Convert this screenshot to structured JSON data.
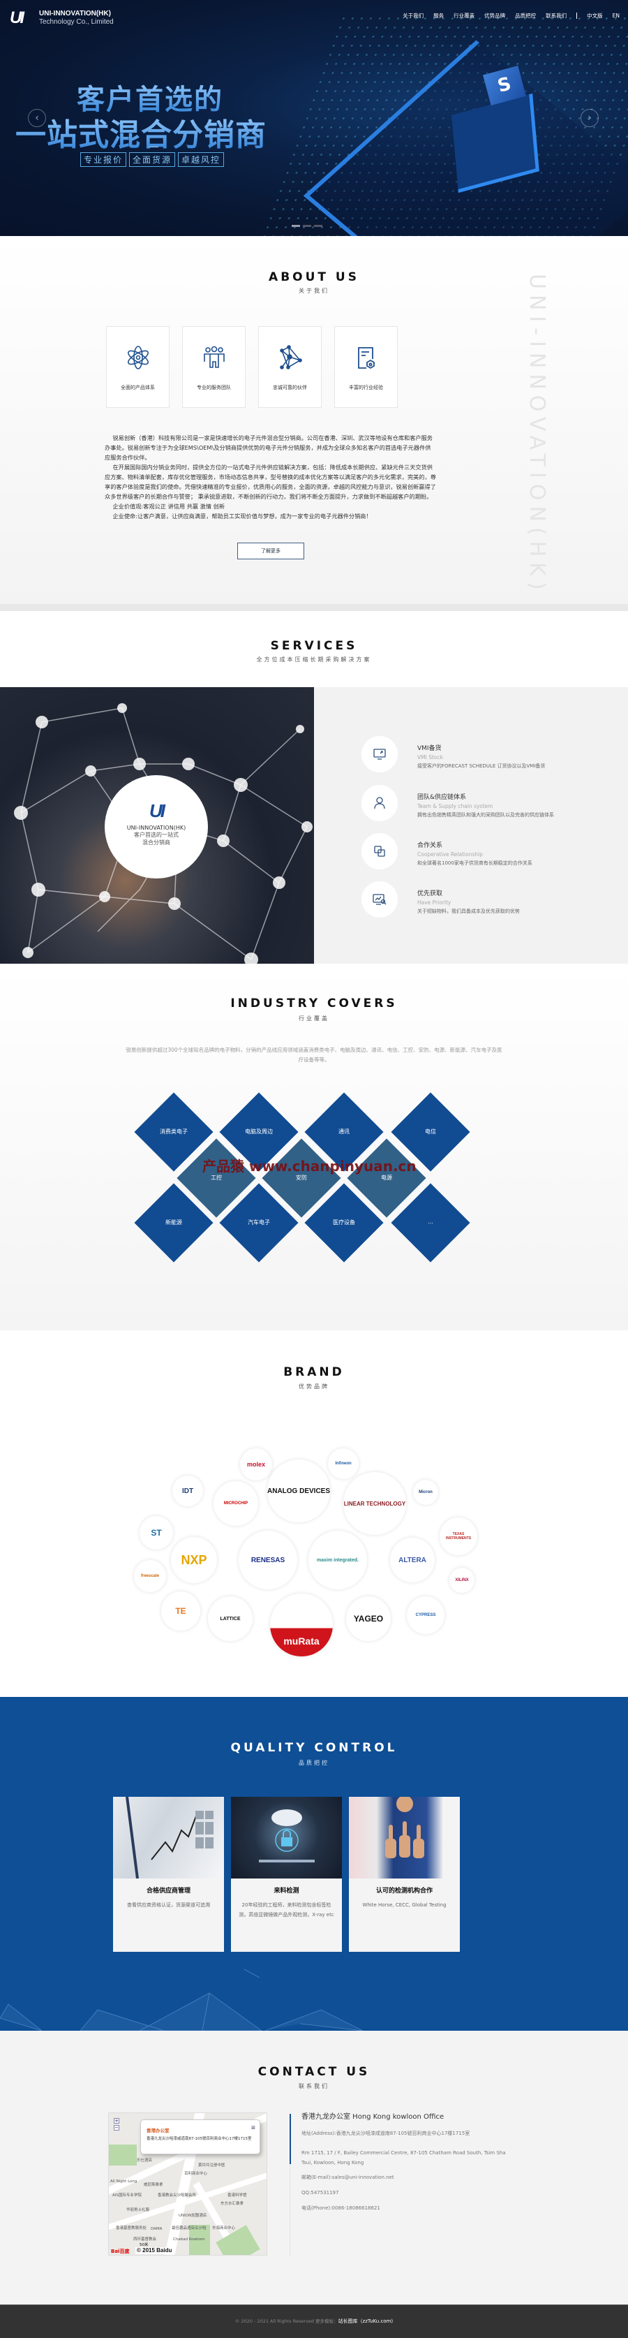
{
  "header": {
    "logo_line1": "UNI-INNOVATION(HK)",
    "logo_line2": "Technology Co., Limited",
    "logo_mark": "UI",
    "nav": [
      "关于我们",
      "服务",
      "行业覆盖",
      "优势品牌",
      "品质把控",
      "联系我们"
    ],
    "lang_cn": "中文版",
    "lang_en": "EN"
  },
  "hero": {
    "title_line1": "客户首选的",
    "title_line2": "一站式混合分销商",
    "tags": [
      "专业报价",
      "全面货源",
      "卓越风控"
    ],
    "chip_mark": "S",
    "prev_icon": "chevron-left-icon",
    "next_icon": "chevron-right-icon",
    "slides": 3,
    "active_slide": 1
  },
  "about": {
    "title": "ABOUT US",
    "subtitle": "关于我们",
    "watermark": "UNI-INNOVATION(HK)",
    "cards": [
      {
        "icon": "atom-icon",
        "label": "全面的产品体系"
      },
      {
        "icon": "team-icon",
        "label": "专业的服务团队"
      },
      {
        "icon": "network-icon",
        "label": "忠诚可靠的伙伴"
      },
      {
        "icon": "certificate-icon",
        "label": "丰富的行业经验"
      }
    ],
    "paragraphs": [
      "锐易创新（香港）科技有限公司是一家是快速增长的电子元件混合型分销商。公司在香港、深圳、武汉等地设有仓库和客户服务办事处。锐易创新专注于为全球EMS\\OEM\\及分销商提供优势的电子元件分销服务，并成为全球众多知名客户的首选电子元器件供应服务合作伙伴。",
      "在开展国际国内分销业务同时，提供全方位的一站式电子元件供应链解决方案，包括：降低成本长期供应、紧缺元件三天交货供应方案、物料清单配套，库存优化管理服务，市场动态信息共享，型号替换的成本优化方案等以满足客户的多元化需求，完美的，尊享的客户体验度是我们的使命。凭借快速精准的专业报价，优质用心的服务，全面的资源，卓越的风控能力与意识，锐易创新赢得了众多世界级客户的长期合作与赞誉； 秉承锐意进取，不断创新的行动力，我们将不断全方面提升，力求做到不断超越客户的期盼。",
      "企业价值观:客观公正 讲信用 共赢 激情 创新",
      "企业使命:让客户满意，让供应商满意，帮助员工实现价值与梦想，成为一家专业的电子元器件分销商！"
    ],
    "more_button": "了解更多"
  },
  "services": {
    "title": "SERVICES",
    "subtitle": "全方位成本压缩长期采购解决方案",
    "circle": {
      "name": "UNI-INNOVATION(HK)",
      "line1": "客户首选的一站式",
      "line2": "混合分销商"
    },
    "items": [
      {
        "icon": "monitor-icon",
        "title": "VMI备货",
        "en": "VMI Stock",
        "desc": "接受客户的FORECAST SCHEDULE 订货协议以及VMI备货"
      },
      {
        "icon": "user-icon",
        "title": "团队&供应链体系",
        "en": "Team & Supply chain system",
        "desc": "拥有出色销售精英团队和强大的采购团队以及完善的供应链体系"
      },
      {
        "icon": "copy-link-icon",
        "title": "合作关系",
        "en": "Cooperative Relationship",
        "desc": "和全球著名1000家电子供货商有长期稳定的合作关系"
      },
      {
        "icon": "chart-search-icon",
        "title": "优先获取",
        "en": "Have Priority",
        "desc": "关于短缺物料，我们具备成本及优先获取的优势"
      }
    ]
  },
  "industry": {
    "title": "INDUSTRY COVERS",
    "subtitle": "行业覆盖",
    "desc": "锐易创新提供超过300个全球知名品牌的电子物料，分销的产品线应用领域涵盖消费类电子、电脑及周边、通讯、电信、工控、安防、电源、新能源、汽车电子及医疗设备等等。",
    "row1": [
      "消费类电子",
      "电脑及周边",
      "通讯",
      "电信"
    ],
    "row2": [
      "工控",
      "安防",
      "电源"
    ],
    "row3": [
      "新能源",
      "汽车电子",
      "医疗设备",
      "..."
    ],
    "colors": {
      "primary": "#114c93",
      "secondary": "#316187"
    },
    "watermark": "产品猿 www.chanpinyuan.cn"
  },
  "brand": {
    "title": "BRAND",
    "subtitle": "优势品牌",
    "logos": [
      "molex",
      "Infineon",
      "ANALOG DEVICES",
      "IDT",
      "MICROCHIP",
      "LINEAR TECHNOLOGY",
      "Micron",
      "ST",
      "TEXAS INSTRUMENTS",
      "NXP",
      "RENESAS",
      "maxim integrated.",
      "ALTERA",
      "freescale",
      "XILINX",
      "TE",
      "LATTICE",
      "muRata",
      "YAGEO",
      "CYPRESS"
    ]
  },
  "quality": {
    "title": "QUALITY CONTROL",
    "subtitle": "品质把控",
    "cards": [
      {
        "title": "合格供应商管理",
        "desc": "查看供应商资格认证，货源渠道可追溯"
      },
      {
        "title": "来料检测",
        "desc": "20年经验的工程师，来料检测包含标签检测，高倍显微镜做产品外观检测，X-ray etc"
      },
      {
        "title": "认可的检测机构合作",
        "desc": "White Horse, CECC, Global Testing"
      }
    ]
  },
  "contact": {
    "title": "CONTACT US",
    "subtitle": "联系我们",
    "office": "香港九龙办公室 Hong Kong kowloon Office",
    "address_cn": "地址(Address):香港九龙尖沙咀漆咸道南87-105號百利商业中心17楼1715室",
    "address_en": "Rm 1715, 17 / F, Bailey Commercial Centre, 87-105 Chatham Road South, Tsim Sha Tsui, Kowloon, Hong Kong",
    "email": "邮箱(E-mail):sales@uni-innovation.net",
    "qq": "QQ:547531197",
    "phone": "电话(Phone):0086-18086618621",
    "map": {
      "popup_title": "香港办公室",
      "popup_text": "香港九龙尖沙咀漆咸道南87-105號百利商业中心17楼1715室",
      "labels": [
        "乐仕酒店",
        "百利商业中心",
        "黄玲玲注册中医",
        "All Night Long",
        "威尼斯桑拿",
        "AIS国际专业学院",
        "香港教会尖沙咀聚会所",
        "华丽男士礼服",
        "UNION加盟酒店",
        "香港科学馆",
        "东方水汇桑拿",
        "香港基督教服务处",
        "DAMA",
        "最佳趣品酒店尖沙咀",
        "东海商业中心",
        "Chabad Kowloon",
        "西环基督教会"
      ],
      "scale": "50米",
      "copyright": "© 2015 Baidu",
      "baidu": "Bai百度"
    }
  },
  "footer": {
    "copyright": "© 2020 - 2021 All Rights Reserved 更多模板：",
    "link": "站长图库（zzTuKu.com)"
  }
}
